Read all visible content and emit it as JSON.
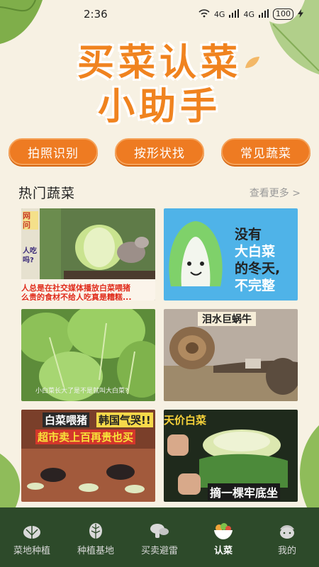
{
  "status_bar": {
    "time": "2:36",
    "network_1": "4G",
    "network_2": "4G",
    "battery": "100"
  },
  "headline": {
    "line1": "买菜认菜",
    "line2": "小助手"
  },
  "actions": [
    {
      "label": "拍照识别"
    },
    {
      "label": "按形状找"
    },
    {
      "label": "常见蔬菜"
    }
  ],
  "section": {
    "title": "热门蔬菜",
    "more": "查看更多 >"
  },
  "cards": [
    {
      "tag": "网\n问",
      "side_text": "人吃\n吗?",
      "caption_1": "人总是在社交媒体播放白菜喂猪",
      "caption_2": "么贵的食材不给人吃真是糟糕..."
    },
    {
      "text_1": "没有",
      "text_2": "大白菜",
      "text_3": "的冬天,",
      "text_4": "不完整"
    },
    {
      "subtitle": "小白菜长大了是不是就叫大白菜?"
    },
    {
      "title": "泪水巨蜗牛"
    },
    {
      "title_1": "白菜喂猪",
      "title_2": "韩国气哭!!",
      "title_3": "超市卖上百再贵也买"
    },
    {
      "title_1": "天价白菜",
      "title_2": "摘一棵牢底坐"
    }
  ],
  "tabs": [
    {
      "label": "菜地种植",
      "icon": "cabbage-icon",
      "active": false
    },
    {
      "label": "种植基地",
      "icon": "leaf-icon",
      "active": false
    },
    {
      "label": "买卖避雷",
      "icon": "mushroom-icon",
      "active": false
    },
    {
      "label": "认菜",
      "icon": "vegetable-bowl-icon",
      "active": true
    },
    {
      "label": "我的",
      "icon": "cabbage-profile-icon",
      "active": false
    }
  ],
  "colors": {
    "accent": "#ee7b22",
    "background": "#f7f1e3",
    "tabbar": "#2d4a2a"
  }
}
